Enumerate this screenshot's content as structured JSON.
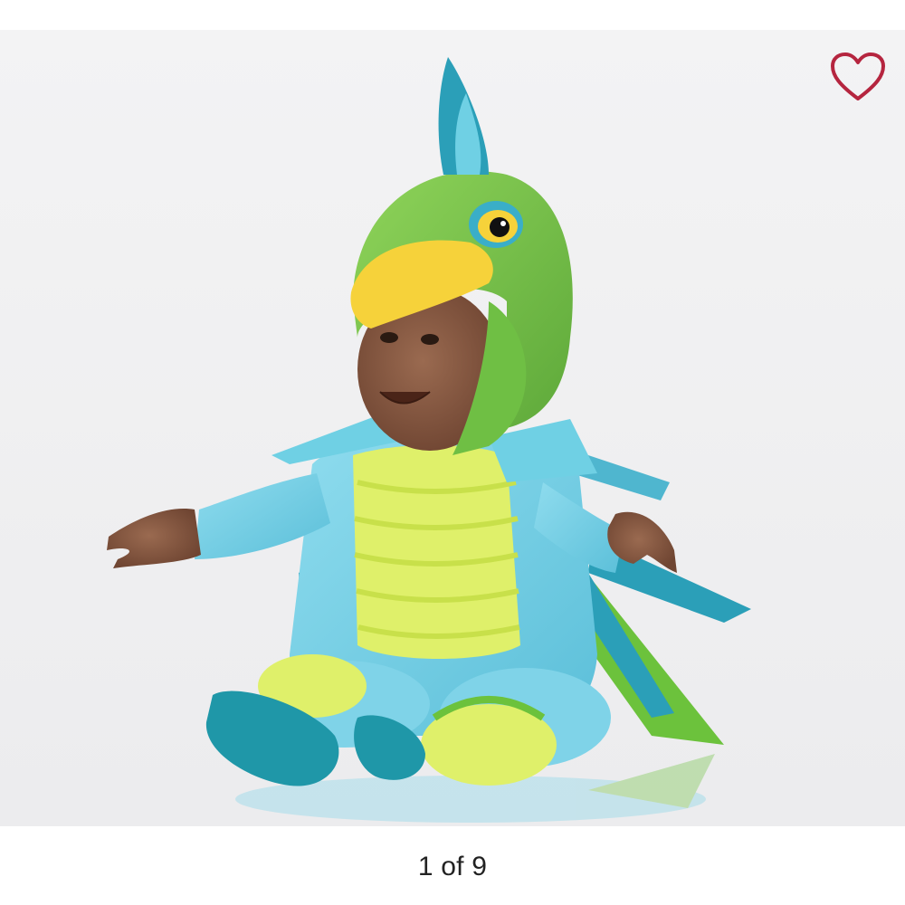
{
  "gallery": {
    "counter": "1 of 9",
    "favorite_icon": "heart-outline-icon",
    "favorite_color": "#b5253f",
    "photo_background": "#f3f3f4",
    "image_subject": "product-photo"
  },
  "palette": {
    "bodysuit": "#7fd3e8",
    "bodysuit_shade": "#5bbfd9",
    "hood_green": "#7ec84a",
    "hood_green_dark": "#5ea93a",
    "beak_yellow": "#f6d23a",
    "ruffle_yellow": "#dff06a",
    "wing_teal": "#2b9fb8",
    "tail_green": "#6cc23c",
    "booties": "#1f97a8",
    "skin": "#8a5a43"
  }
}
